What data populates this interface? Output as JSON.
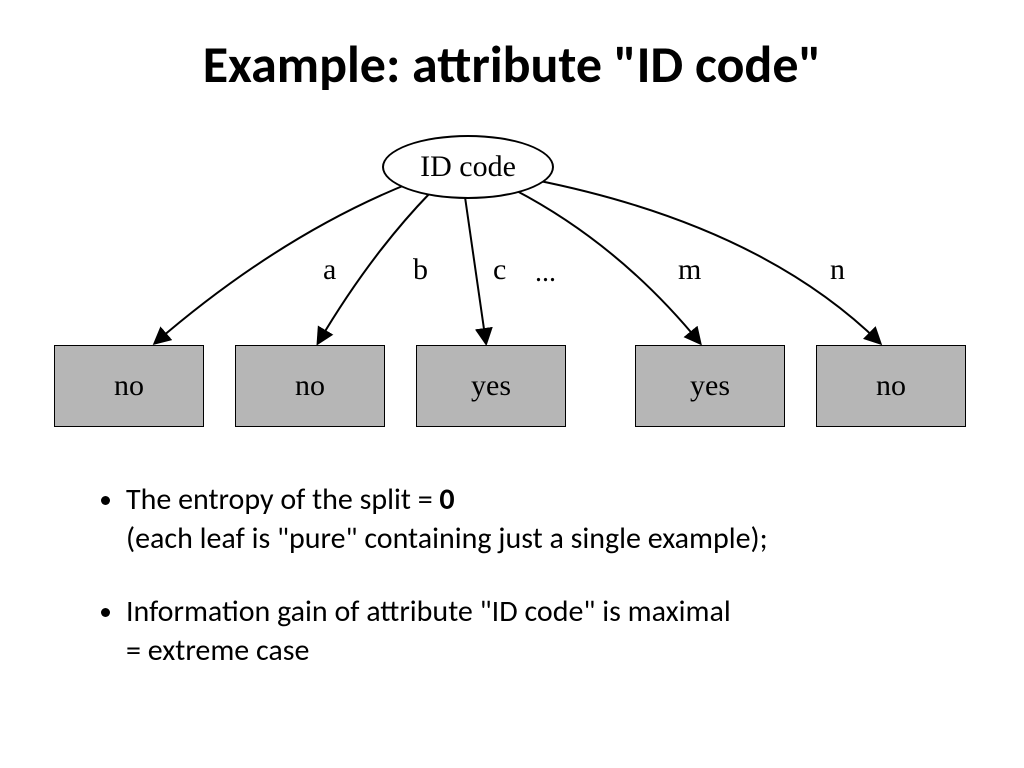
{
  "title": "Example: attribute \"ID code\"",
  "root": "ID code",
  "branches": [
    "a",
    "b",
    "c",
    "m",
    "n"
  ],
  "branch_ellipsis": "...",
  "leaves": [
    "no",
    "no",
    "yes",
    "yes",
    "no"
  ],
  "bullet1_line1_prefix": "The entropy of the split = ",
  "bullet1_line1_bold": "0",
  "bullet1_line2": "(each leaf is \"pure\" containing just a single example);",
  "bullet2_line1": "Information gain of attribute \"ID code\" is maximal",
  "bullet2_line2": "= extreme case"
}
